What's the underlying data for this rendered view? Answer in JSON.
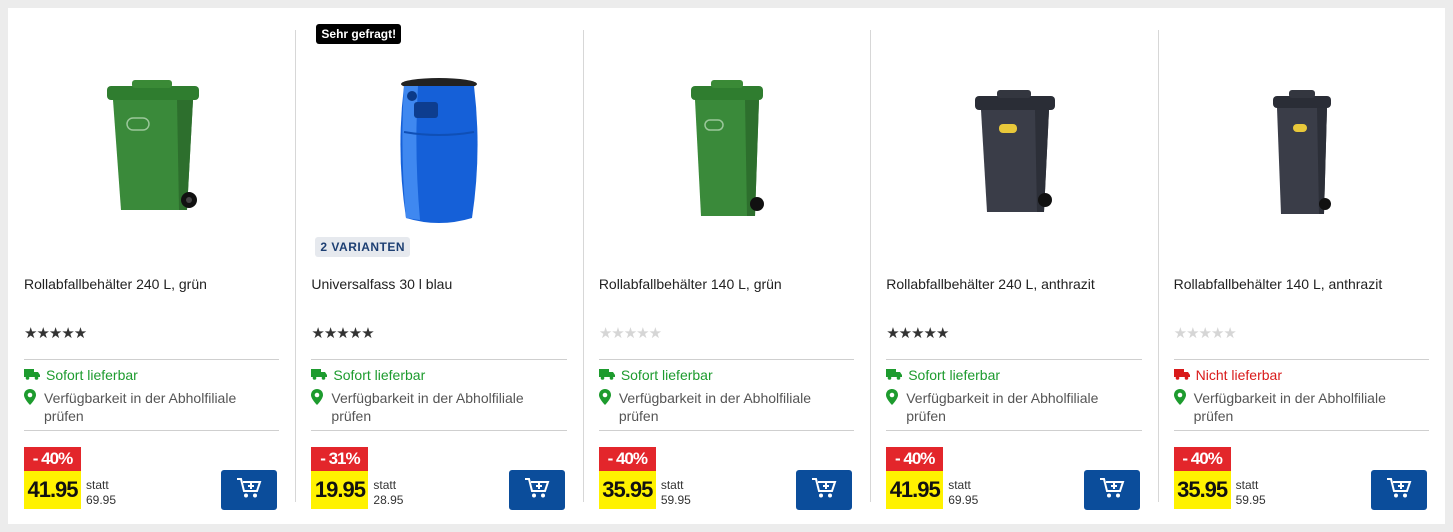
{
  "products": [
    {
      "badge": "",
      "variants": "",
      "title": "Rollabfallbehälter 240 L, grün",
      "stars": "★★★★★",
      "rated": true,
      "delivery": "Sofort lieferbar",
      "delivery_ok": true,
      "pickup": "Verfügbarkeit in der Abholfiliale prüfen",
      "discount": "- 40%",
      "price": "41.95",
      "statt_label": "statt",
      "old_price": "69.95",
      "image": "green-bin-240-icon"
    },
    {
      "badge": "Sehr gefragt!",
      "variants": "2 VARIANTEN",
      "title": "Universalfass 30 l blau",
      "stars": "★★★★★",
      "rated": true,
      "delivery": "Sofort lieferbar",
      "delivery_ok": true,
      "pickup": "Verfügbarkeit in der Abholfiliale prüfen",
      "discount": "- 31%",
      "price": "19.95",
      "statt_label": "statt",
      "old_price": "28.95",
      "image": "blue-barrel-icon"
    },
    {
      "badge": "",
      "variants": "",
      "title": "Rollabfallbehälter 140 L, grün",
      "stars": "★★★★★",
      "rated": false,
      "delivery": "Sofort lieferbar",
      "delivery_ok": true,
      "pickup": "Verfügbarkeit in der Abholfiliale prüfen",
      "discount": "- 40%",
      "price": "35.95",
      "statt_label": "statt",
      "old_price": "59.95",
      "image": "green-bin-140-icon"
    },
    {
      "badge": "",
      "variants": "",
      "title": "Rollabfallbehälter 240 L, anthrazit",
      "stars": "★★★★★",
      "rated": true,
      "delivery": "Sofort lieferbar",
      "delivery_ok": true,
      "pickup": "Verfügbarkeit in der Abholfiliale prüfen",
      "discount": "- 40%",
      "price": "41.95",
      "statt_label": "statt",
      "old_price": "69.95",
      "image": "anthracite-bin-240-icon"
    },
    {
      "badge": "",
      "variants": "",
      "title": "Rollabfallbehälter 140 L, anthrazit",
      "stars": "★★★★★",
      "rated": false,
      "delivery": "Nicht lieferbar",
      "delivery_ok": false,
      "pickup": "Verfügbarkeit in der Abholfiliale prüfen",
      "discount": "- 40%",
      "price": "35.95",
      "statt_label": "statt",
      "old_price": "59.95",
      "image": "anthracite-bin-140-icon"
    }
  ],
  "colors": {
    "green": "#1d9b2e",
    "red": "#d91a1a",
    "cart_blue": "#0b4d9b",
    "price_yellow": "#fff200",
    "discount_red": "#e3262b"
  }
}
